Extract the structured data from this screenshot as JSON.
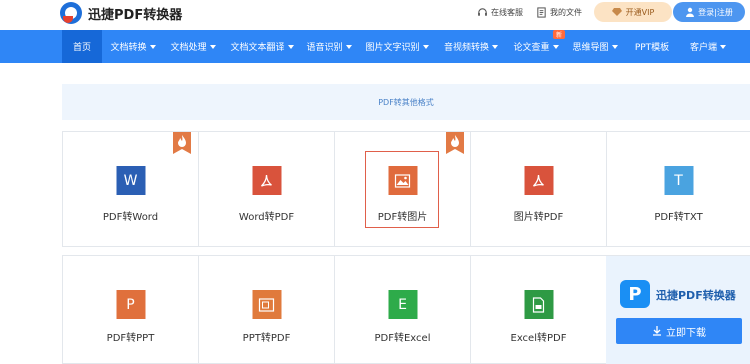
{
  "header": {
    "logo_text": "迅捷PDF转换器",
    "service_label": "在线客服",
    "files_label": "我的文件",
    "vip_label": "开通VIP",
    "login_label": "登录|注册"
  },
  "nav": {
    "items": [
      {
        "label": "首页"
      },
      {
        "label": "文档转换"
      },
      {
        "label": "文档处理"
      },
      {
        "label": "文档文本翻译"
      },
      {
        "label": "语音识别"
      },
      {
        "label": "图片文字识别"
      },
      {
        "label": "音视频转换"
      },
      {
        "label": "论文查重"
      },
      {
        "label": "思维导图"
      },
      {
        "label": "PPT模板"
      },
      {
        "label": "客户端"
      }
    ],
    "new_badge": "新"
  },
  "banner": {
    "text": "PDF转其他格式"
  },
  "tools_row1": [
    {
      "label": "PDF转Word",
      "glyph": "W",
      "color": "#2b5fb4",
      "hot": true
    },
    {
      "label": "Word转PDF",
      "glyph": "pdf",
      "color": "#d9533c",
      "hot": false
    },
    {
      "label": "PDF转图片",
      "glyph": "img",
      "color": "#e06b3d",
      "hot": true
    },
    {
      "label": "图片转PDF",
      "glyph": "pdf",
      "color": "#d9533c",
      "hot": false
    },
    {
      "label": "PDF转TXT",
      "glyph": "T",
      "color": "#4aa3e0",
      "hot": false
    }
  ],
  "tools_row2": [
    {
      "label": "PDF转PPT",
      "glyph": "P",
      "color": "#e0703c"
    },
    {
      "label": "PPT转PDF",
      "glyph": "ppt",
      "color": "#e07a3c"
    },
    {
      "label": "PDF转Excel",
      "glyph": "E",
      "color": "#2eab4a"
    },
    {
      "label": "Excel转PDF",
      "glyph": "xls",
      "color": "#2e9a44"
    }
  ],
  "promo": {
    "logo_glyph": "P",
    "name": "迅捷PDF转换器",
    "download_label": "立即下载"
  },
  "colors": {
    "nav_bg": "#2f86f6",
    "nav_active": "#1668d8",
    "accent_orange": "#e27a45",
    "highlight_border": "#e05f4a"
  }
}
